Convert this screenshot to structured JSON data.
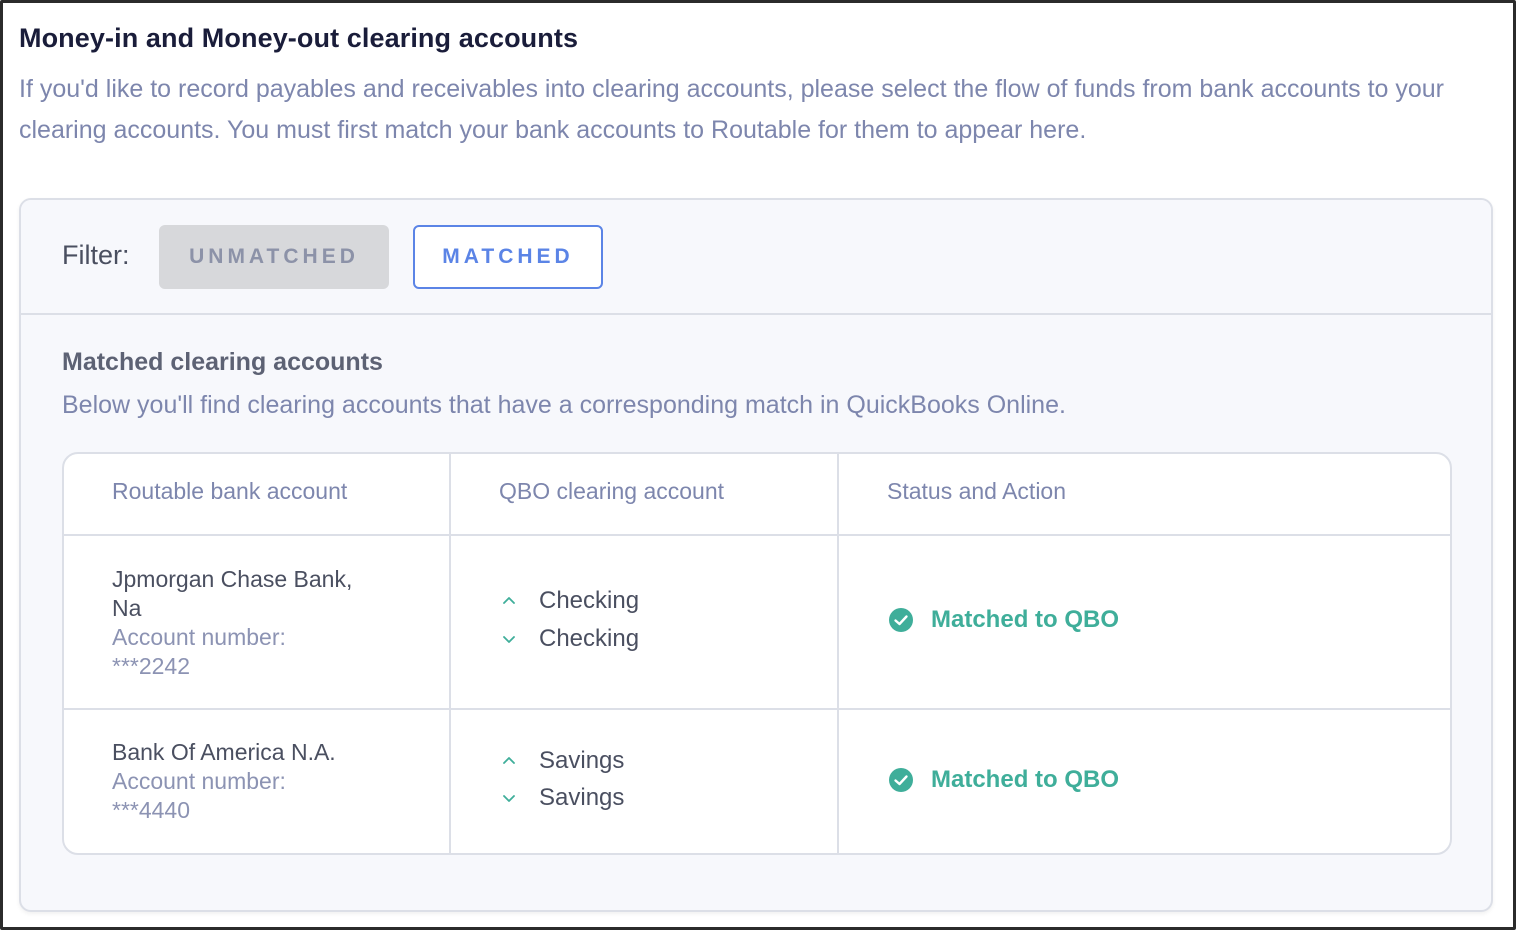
{
  "header": {
    "title": "Money-in and Money-out clearing accounts",
    "description": "If you'd like to record payables and receivables into clearing accounts, please select the flow of funds from bank accounts to your clearing accounts. You must first match your bank accounts to Routable for them to appear here."
  },
  "filter": {
    "label": "Filter:",
    "unmatched_label": "UNMATCHED",
    "matched_label": "MATCHED",
    "active": "MATCHED"
  },
  "section": {
    "title": "Matched clearing accounts",
    "description": "Below you'll find clearing accounts that have a corresponding match in QuickBooks Online."
  },
  "table": {
    "columns": [
      "Routable bank account",
      "QBO clearing account",
      "Status and Action"
    ],
    "rows": [
      {
        "bank_name_line1": "Jpmorgan Chase Bank,",
        "bank_name_line2": "Na",
        "account_label": "Account number:",
        "account_number": "***2242",
        "qbo_up": "Checking",
        "qbo_down": "Checking",
        "status": "Matched to QBO",
        "status_icon": "check-circle-icon"
      },
      {
        "bank_name_line1": "Bank Of America N.A.",
        "account_label": "Account number:",
        "account_number": "***4440",
        "qbo_up": "Savings",
        "qbo_down": "Savings",
        "status": "Matched to QBO",
        "status_icon": "check-circle-icon"
      }
    ]
  },
  "colors": {
    "accent": "#5b84e6",
    "success": "#3fae9a",
    "muted_text": "#7d86ad",
    "title_text": "#1a1d3a"
  }
}
